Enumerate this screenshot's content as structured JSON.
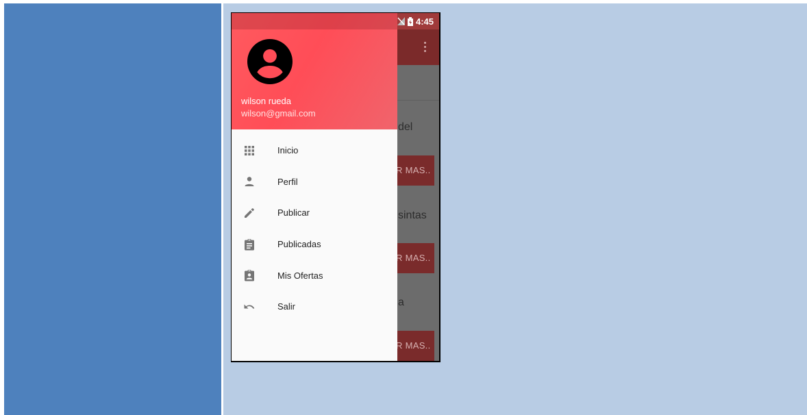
{
  "status_bar": {
    "time": "4:45"
  },
  "drawer": {
    "user_name": "wilson rueda",
    "user_email": "wilson@gmail.com",
    "items": [
      {
        "label": "Inicio",
        "icon": "apps-grid-icon"
      },
      {
        "label": "Perfil",
        "icon": "person-icon"
      },
      {
        "label": "Publicar",
        "icon": "pencil-icon"
      },
      {
        "label": "Publicadas",
        "icon": "clipboard-icon"
      },
      {
        "label": "Mis Ofertas",
        "icon": "assignment-ind-icon"
      },
      {
        "label": "Salir",
        "icon": "undo-icon"
      }
    ]
  },
  "background_content": {
    "text_1": "del",
    "button_1": "R MAS..",
    "text_2": "sintas",
    "button_2": "R MAS..",
    "text_3": "a",
    "button_3": "R MAS.."
  },
  "colors": {
    "left_panel": "#4e81bd",
    "right_panel": "#b8cce4",
    "header_accent": "#ff4d57",
    "drawer_background": "#fafafa"
  }
}
